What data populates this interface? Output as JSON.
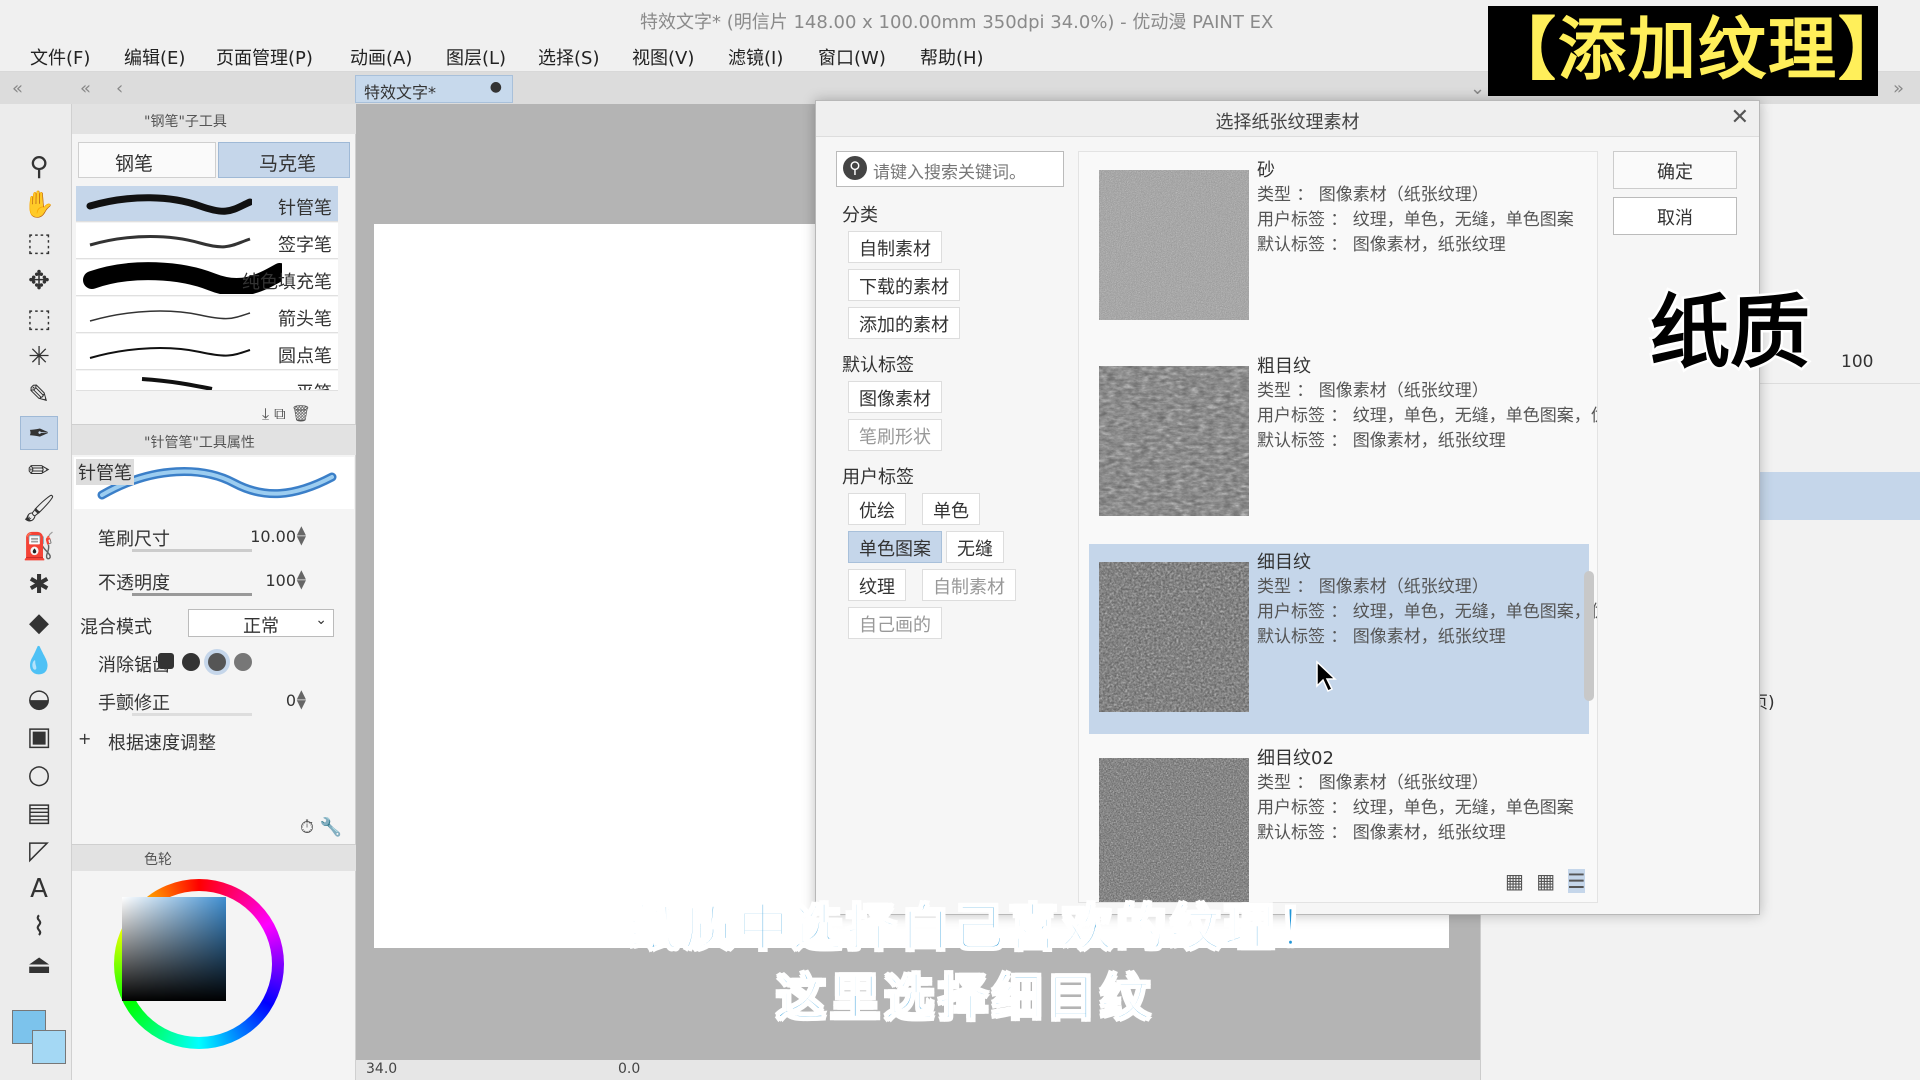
{
  "window": {
    "title": "特效文字* (明信片 148.00 x 100.00mm 350dpi 34.0%) - 优动漫 PAINT EX"
  },
  "menu": [
    "文件(F)",
    "编辑(E)",
    "页面管理(P)",
    "动画(A)",
    "图层(L)",
    "选择(S)",
    "视图(V)",
    "滤镜(I)",
    "窗口(W)",
    "帮助(H)"
  ],
  "document_tab": {
    "label": "特效文字*",
    "modified_dot": "●"
  },
  "subtool_panel": {
    "header": "\"钢笔\"子工具",
    "groups": [
      "钢笔",
      "马克笔"
    ],
    "active_group": "马克笔",
    "brushes": [
      "针管笔",
      "签字笔",
      "纯色填充笔",
      "箭头笔",
      "圆点笔",
      "平笔"
    ],
    "active_brush": "针管笔"
  },
  "tool_property": {
    "header": "\"针管笔\"工具属性",
    "preview_label": "针管笔",
    "brush_size_label": "笔刷尺寸",
    "brush_size_value": "10.00",
    "opacity_label": "不透明度",
    "opacity_value": "100",
    "blend_label": "混合模式",
    "blend_value": "正常",
    "antialias_label": "消除锯齿",
    "stabilization_label": "手颤修正",
    "stabilization_value": "0",
    "speed_label": "根据速度调整",
    "speed_expand": "+"
  },
  "color_panel": {
    "header": "色轮"
  },
  "statusbar": {
    "zoom": "34.0",
    "angle": "0.0"
  },
  "right_panel": {
    "value": "100",
    "partial_text": "页)"
  },
  "dialog": {
    "title": "选择纸张纹理素材",
    "close": "✕",
    "search_placeholder": "请键入搜索关键词。",
    "category_label": "分类",
    "categories": [
      "自制素材",
      "下载的素材",
      "添加的素材"
    ],
    "default_tags_label": "默认标签",
    "default_tags": [
      "图像素材",
      "笔刷形状"
    ],
    "user_tags_label": "用户标签",
    "user_tags": [
      "优绘",
      "单色",
      "单色图案",
      "无缝",
      "纹理",
      "自制素材",
      "自己画的"
    ],
    "ok": "确定",
    "cancel": "取消",
    "materials": [
      {
        "name": "砂",
        "type": "类型 ： 图像素材（纸张纹理）",
        "user_tags": "用户标签 ： 纹理，单色，无缝，单色图案",
        "default_tags": "默认标签 ： 图像素材，纸张纹理",
        "selected": false
      },
      {
        "name": "粗目纹",
        "type": "类型 ： 图像素材（纸张纹理）",
        "user_tags": "用户标签 ： 纹理，单色，无缝，单色图案，优绘",
        "default_tags": "默认标签 ： 图像素材，纸张纹理",
        "selected": false
      },
      {
        "name": "细目纹",
        "type": "类型 ： 图像素材（纸张纹理）",
        "user_tags": "用户标签 ： 纹理，单色，无缝，单色图案，优绘",
        "default_tags": "默认标签 ： 图像素材，纸张纹理",
        "selected": true
      },
      {
        "name": "细目纹02",
        "type": "类型 ： 图像素材（纸张纹理）",
        "user_tags": "用户标签 ： 纹理，单色，无缝，单色图案",
        "default_tags": "默认标签 ： 图像素材，纸张纹理",
        "selected": false
      }
    ]
  },
  "overlays": {
    "title_banner": "【添加纹理】",
    "paper_label": "纸质",
    "subtitle_line1": "纸质中选择自己喜欢的纹理！",
    "subtitle_line2": "这里选择细目纹"
  },
  "colors": {
    "selection": "#c5d6ea",
    "banner_text": "#ffef5a",
    "subtitle_text": "#2196d8",
    "primary_color": "#3f8ed0"
  }
}
